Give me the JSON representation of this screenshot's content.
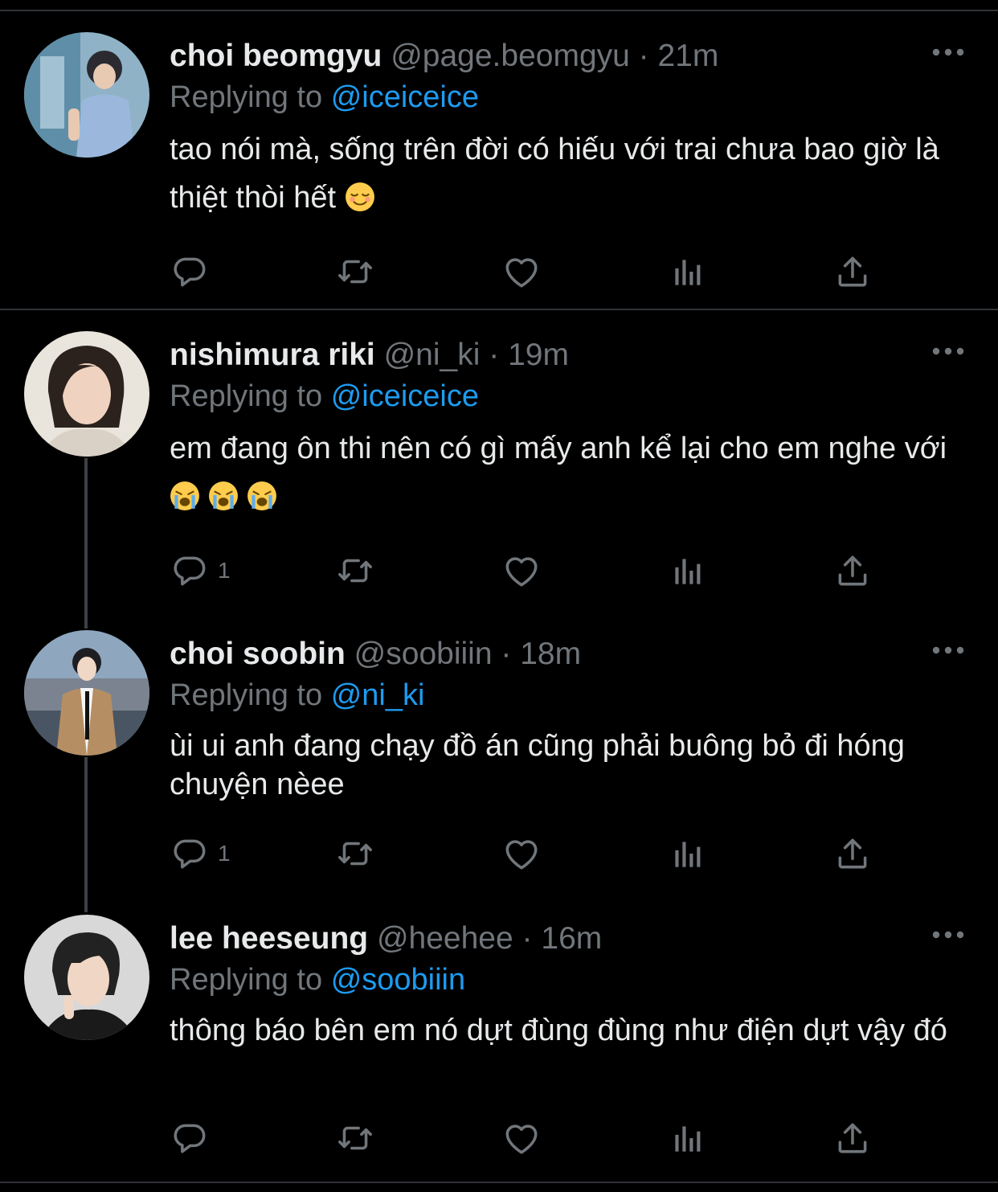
{
  "tweets": [
    {
      "name": "choi beomgyu",
      "handle": "@page.beomgyu",
      "dot": "·",
      "time": "21m",
      "replying_prefix": "Replying to",
      "replying_to": "@iceiceice",
      "text": "tao nói mà, sống trên đời có hiếu với trai chưa bao giờ là thiệt thòi hết",
      "emojis": [
        "relieved-face"
      ],
      "reply_count": ""
    },
    {
      "name": "nishimura riki",
      "handle": "@ni_ki",
      "dot": "·",
      "time": "19m",
      "replying_prefix": "Replying to",
      "replying_to": "@iceiceice",
      "text": "em đang ôn thi nên có gì mấy anh kể lại cho em nghe với",
      "emojis": [
        "loudly-crying-face",
        "loudly-crying-face",
        "loudly-crying-face"
      ],
      "reply_count": "1"
    },
    {
      "name": "choi soobin",
      "handle": "@soobiiin",
      "dot": "·",
      "time": "18m",
      "replying_prefix": "Replying to",
      "replying_to": "@ni_ki",
      "text": "ùi ui anh đang chạy đồ án cũng phải buông bỏ đi hóng chuyện nèee",
      "emojis": [],
      "reply_count": "1"
    },
    {
      "name": "lee heeseung",
      "handle": "@heehee",
      "dot": "·",
      "time": "16m",
      "replying_prefix": "Replying to",
      "replying_to": "@soobiiin",
      "text": "thông báo bên em nó dựt đùng đùng như điện dựt vậy đó",
      "emojis": [],
      "reply_count": ""
    }
  ],
  "icons": [
    "more-icon",
    "reply-icon",
    "retweet-icon",
    "like-icon",
    "analytics-icon",
    "share-icon"
  ],
  "colors": {
    "background": "#000000",
    "text": "#e7e9ea",
    "muted": "#71767b",
    "accent": "#1d9bf0",
    "divider": "#2f3336"
  }
}
